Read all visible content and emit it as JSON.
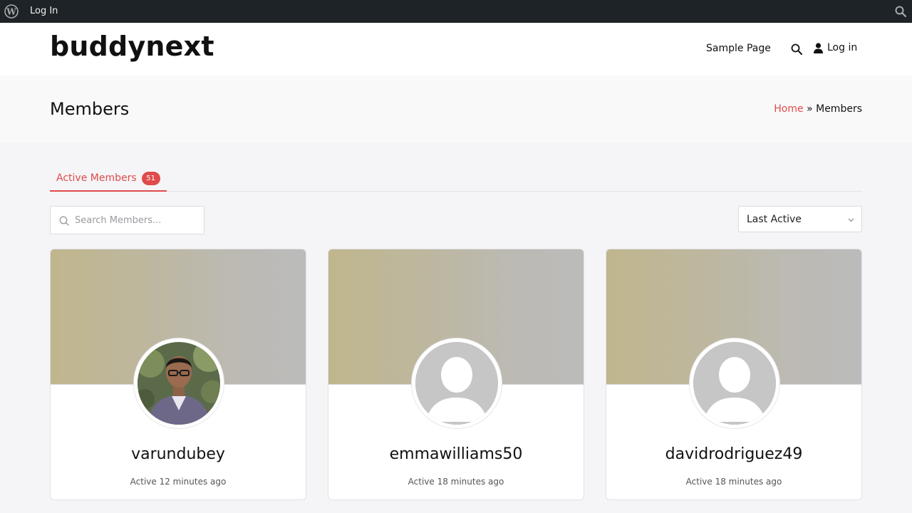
{
  "admin_bar": {
    "login_label": "Log In"
  },
  "header": {
    "brand": "buddynext",
    "nav": {
      "sample_page": "Sample Page",
      "login": "Log in"
    }
  },
  "page": {
    "title": "Members",
    "breadcrumb": {
      "home": "Home",
      "separator": "»",
      "current": "Members"
    }
  },
  "tabs": [
    {
      "label": "Active Members",
      "count": "51"
    }
  ],
  "search": {
    "placeholder": "Search Members..."
  },
  "sort": {
    "selected": "Last Active"
  },
  "members": [
    {
      "name": "varundubey",
      "activity": "Active 12 minutes ago",
      "avatar": "photo"
    },
    {
      "name": "emmawilliams50",
      "activity": "Active 18 minutes ago",
      "avatar": "default"
    },
    {
      "name": "davidrodriguez49",
      "activity": "Active 18 minutes ago",
      "avatar": "default"
    }
  ],
  "colors": {
    "accent": "#e04b4b",
    "admin_bar": "#1d2327"
  }
}
